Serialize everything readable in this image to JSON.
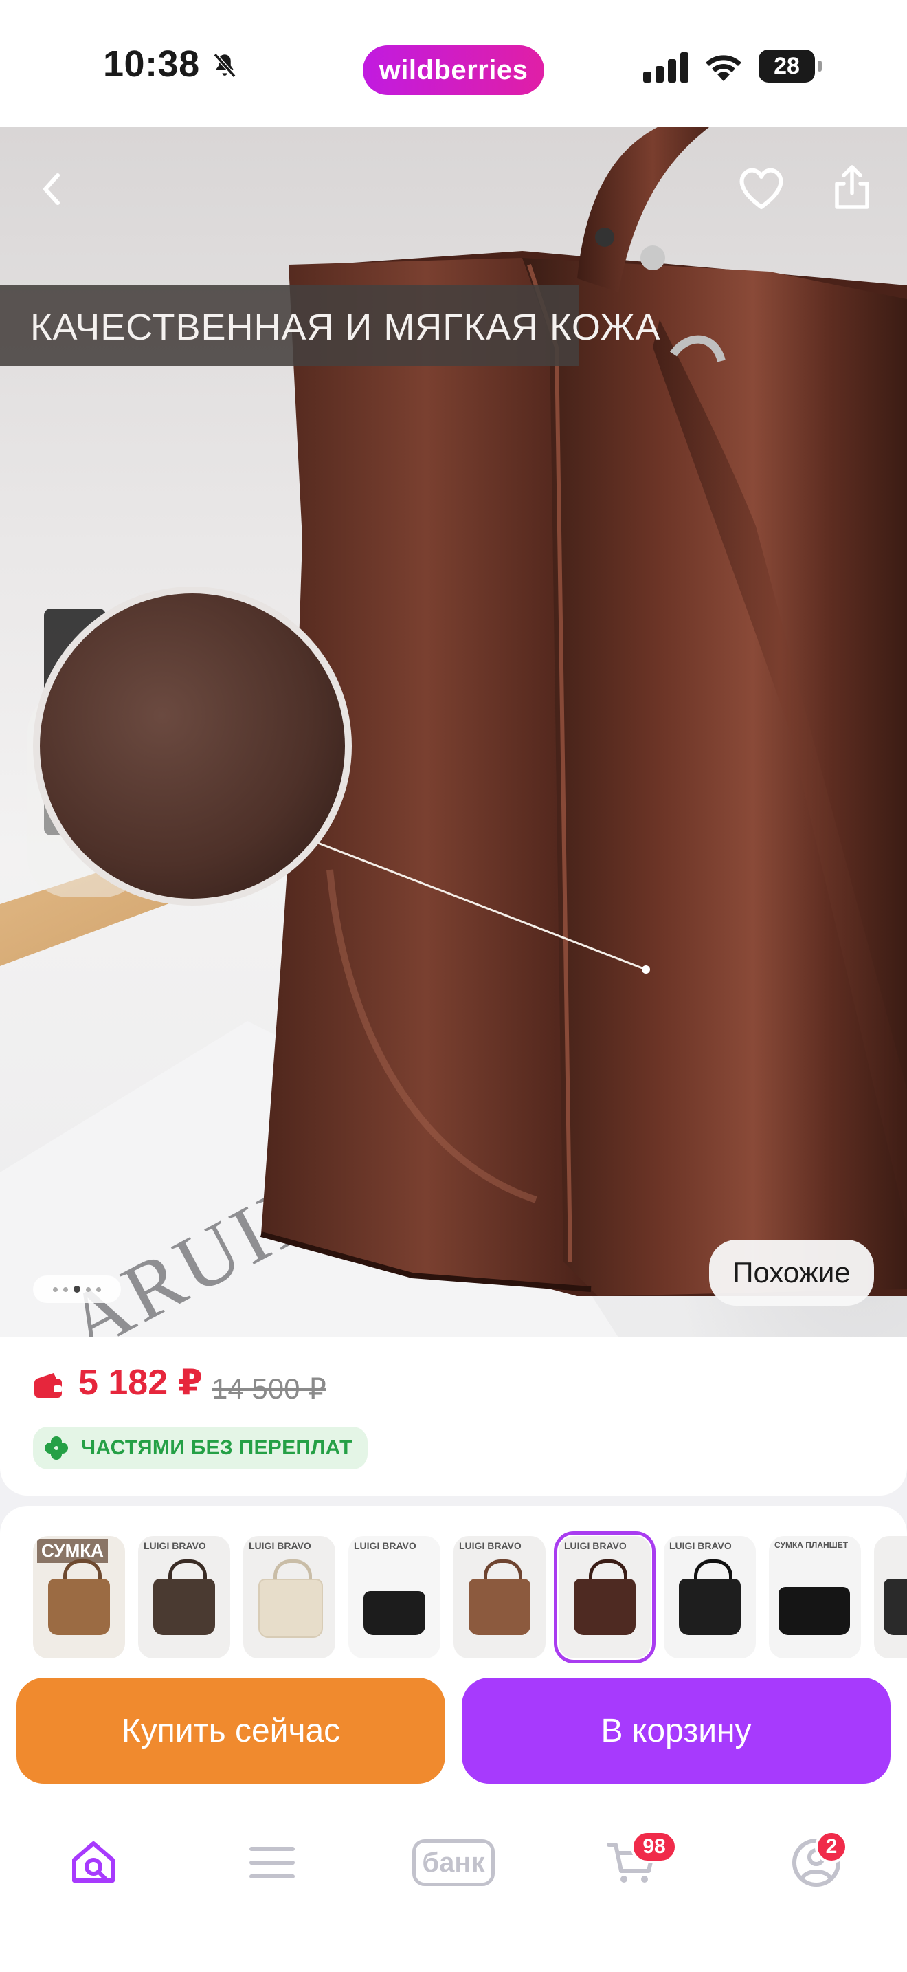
{
  "status_bar": {
    "time": "10:38",
    "brand": "wildberries",
    "battery": "28",
    "icons": [
      "bell-off-icon",
      "signal-icon",
      "wifi-icon",
      "battery-icon"
    ]
  },
  "hero": {
    "banner_text": "КАЧЕСТВЕННАЯ И МЯГКАЯ КОЖА",
    "similar_label": "Похожие",
    "background_print": "ARUILAN PRES",
    "page_dots": 5,
    "active_dot": 3
  },
  "price": {
    "current": "5 182 ₽",
    "old": "14 500 ₽",
    "installment": "ЧАСТЯМИ БЕЗ ПЕРЕПЛАТ",
    "current_color": "#e6263c",
    "installment_color": "#25a046"
  },
  "thumbnails": [
    {
      "label": "СУМКА",
      "bag_color": "#9b6b43",
      "active": false
    },
    {
      "label": "LUIGI BRAVO",
      "bag_color": "#4a3a31",
      "active": false
    },
    {
      "label": "LUIGI BRAVO",
      "bag_color": "#e7ddca",
      "active": false
    },
    {
      "label": "LUIGI BRAVO",
      "bag_color": "#1c1c1c",
      "active": false
    },
    {
      "label": "LUIGI BRAVO",
      "bag_color": "#8c5a3e",
      "active": false
    },
    {
      "label": "LUIGI BRAVO",
      "bag_color": "#4e2a22",
      "active": true
    },
    {
      "label": "LUIGI BRAVO",
      "bag_color": "#1e1e1e",
      "active": false
    },
    {
      "label": "СУМКА ПЛАНШЕТ",
      "bag_color": "#151515",
      "active": false
    },
    {
      "label": "",
      "bag_color": "#2a2a2a",
      "active": false
    }
  ],
  "actions": {
    "buy_now": "Купить сейчас",
    "add_to_cart": "В корзину",
    "buy_color": "#f08a2e",
    "cart_color": "#a73afd"
  },
  "bottom_nav": {
    "bank_label": "банк",
    "cart_badge": "98",
    "profile_badge": "2",
    "items": [
      "home-search-icon",
      "menu-icon",
      "bank-icon",
      "cart-icon",
      "profile-icon"
    ],
    "active_color": "#a73afd"
  }
}
